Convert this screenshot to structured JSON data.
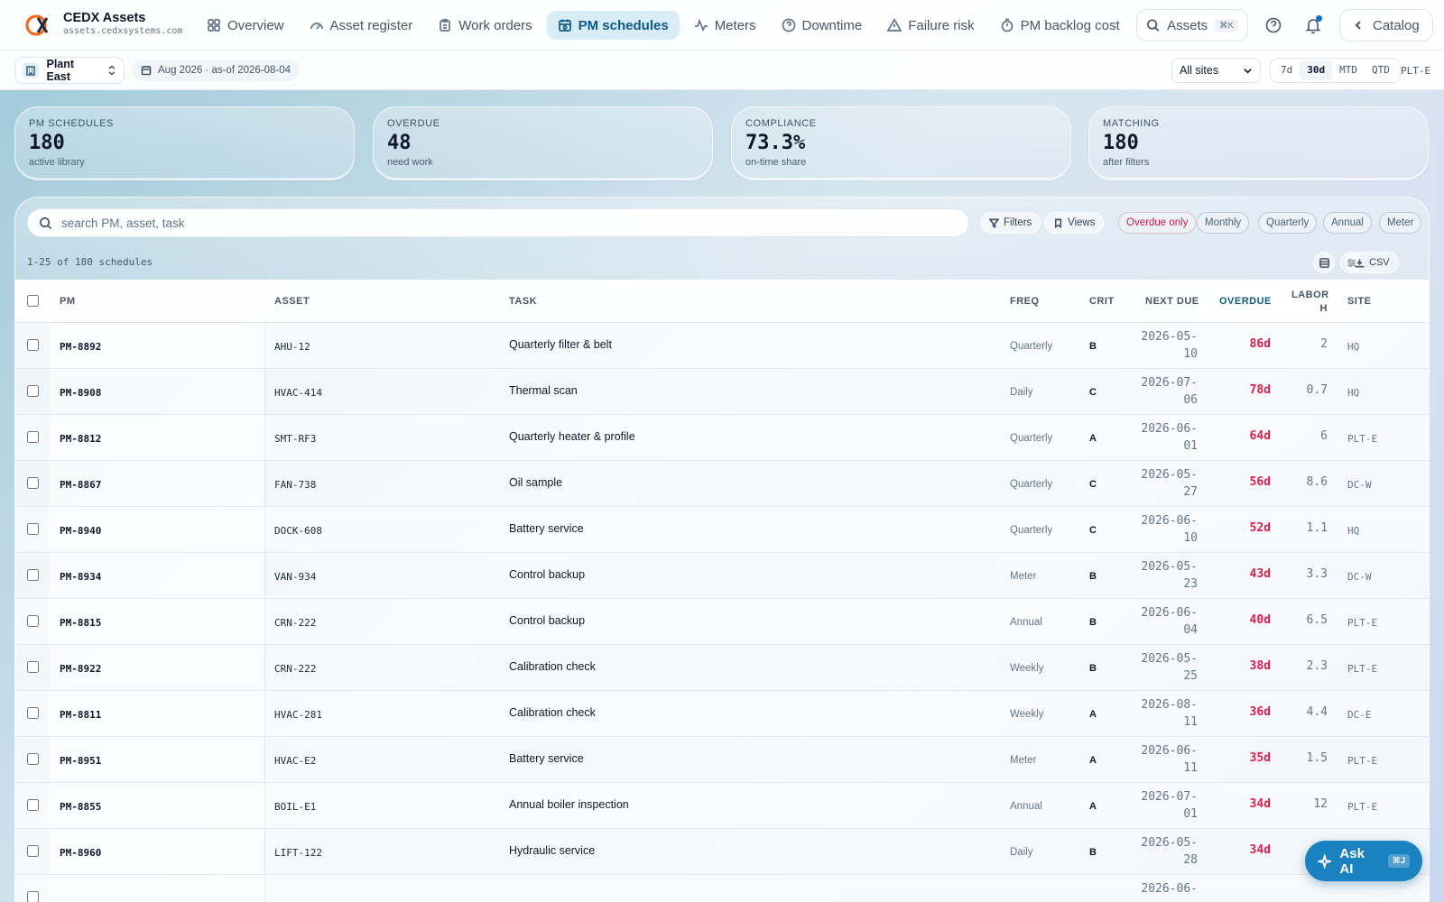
{
  "app": {
    "name": "CEDX Assets",
    "url": "assets.cedxsystems.com"
  },
  "nav": {
    "items": [
      {
        "label": "Overview",
        "icon": "grid-icon"
      },
      {
        "label": "Asset register",
        "icon": "gauge-icon"
      },
      {
        "label": "Work orders",
        "icon": "clipboard-icon"
      },
      {
        "label": "PM schedules",
        "icon": "calendar-icon",
        "active": true
      },
      {
        "label": "Meters",
        "icon": "activity-icon"
      },
      {
        "label": "Downtime",
        "icon": "help-circle-icon"
      },
      {
        "label": "Failure risk",
        "icon": "warning-icon"
      },
      {
        "label": "PM backlog cost",
        "icon": "timer-icon"
      }
    ],
    "search_label": "Assets",
    "search_kbd": "⌘K",
    "catalog_label": "Catalog"
  },
  "subbar": {
    "plant": "Plant East",
    "date_range": "Aug 2026 · as-of 2026-08-04",
    "sites": "All sites",
    "ranges": [
      "7d",
      "30d",
      "MTD",
      "QTD"
    ],
    "active_range": "30d",
    "site_code": "PLT-E"
  },
  "stats": [
    {
      "label": "PM SCHEDULES",
      "value": "180",
      "sub": "active library"
    },
    {
      "label": "OVERDUE",
      "value": "48",
      "sub": "need work"
    },
    {
      "label": "COMPLIANCE",
      "value": "73.3%",
      "sub": "on-time share"
    },
    {
      "label": "MATCHING",
      "value": "180",
      "sub": "after filters"
    }
  ],
  "toolbar": {
    "search_placeholder": "search PM, asset, task",
    "filters_label": "Filters",
    "views_label": "Views",
    "chips": [
      "Overdue only",
      "Monthly",
      "Quarterly",
      "Annual",
      "Meter"
    ],
    "count_text": "1-25 of 180 schedules",
    "csv_label": "CSV"
  },
  "table": {
    "headers": {
      "pm": "PM",
      "asset": "ASSET",
      "task": "TASK",
      "freq": "FREQ",
      "crit": "CRIT",
      "next_due": "NEXT DUE",
      "overdue": "OVERDUE",
      "labor": "LABOR H",
      "site": "SITE"
    },
    "rows": [
      {
        "pm": "PM-8892",
        "asset": "AHU-12",
        "task": "Quarterly filter & belt",
        "freq": "Quarterly",
        "crit": "B",
        "due": "2026-05-10",
        "overdue": "86d",
        "labor": "2",
        "site": "HQ"
      },
      {
        "pm": "PM-8908",
        "asset": "HVAC-414",
        "task": "Thermal scan",
        "freq": "Daily",
        "crit": "C",
        "due": "2026-07-06",
        "overdue": "78d",
        "labor": "0.7",
        "site": "HQ"
      },
      {
        "pm": "PM-8812",
        "asset": "SMT-RF3",
        "task": "Quarterly heater & profile",
        "freq": "Quarterly",
        "crit": "A",
        "due": "2026-06-01",
        "overdue": "64d",
        "labor": "6",
        "site": "PLT-E"
      },
      {
        "pm": "PM-8867",
        "asset": "FAN-738",
        "task": "Oil sample",
        "freq": "Quarterly",
        "crit": "C",
        "due": "2026-05-27",
        "overdue": "56d",
        "labor": "8.6",
        "site": "DC-W"
      },
      {
        "pm": "PM-8940",
        "asset": "DOCK-608",
        "task": "Battery service",
        "freq": "Quarterly",
        "crit": "C",
        "due": "2026-06-10",
        "overdue": "52d",
        "labor": "1.1",
        "site": "HQ"
      },
      {
        "pm": "PM-8934",
        "asset": "VAN-934",
        "task": "Control backup",
        "freq": "Meter",
        "crit": "B",
        "due": "2026-05-23",
        "overdue": "43d",
        "labor": "3.3",
        "site": "DC-W"
      },
      {
        "pm": "PM-8815",
        "asset": "CRN-222",
        "task": "Control backup",
        "freq": "Annual",
        "crit": "B",
        "due": "2026-06-04",
        "overdue": "40d",
        "labor": "6.5",
        "site": "PLT-E"
      },
      {
        "pm": "PM-8922",
        "asset": "CRN-222",
        "task": "Calibration check",
        "freq": "Weekly",
        "crit": "B",
        "due": "2026-05-25",
        "overdue": "38d",
        "labor": "2.3",
        "site": "PLT-E"
      },
      {
        "pm": "PM-8811",
        "asset": "HVAC-281",
        "task": "Calibration check",
        "freq": "Weekly",
        "crit": "A",
        "due": "2026-08-11",
        "overdue": "36d",
        "labor": "4.4",
        "site": "DC-E"
      },
      {
        "pm": "PM-8951",
        "asset": "HVAC-E2",
        "task": "Battery service",
        "freq": "Meter",
        "crit": "A",
        "due": "2026-06-11",
        "overdue": "35d",
        "labor": "1.5",
        "site": "PLT-E"
      },
      {
        "pm": "PM-8855",
        "asset": "BOIL-E1",
        "task": "Annual boiler inspection",
        "freq": "Annual",
        "crit": "A",
        "due": "2026-07-01",
        "overdue": "34d",
        "labor": "12",
        "site": "PLT-E"
      },
      {
        "pm": "PM-8960",
        "asset": "LIFT-122",
        "task": "Hydraulic service",
        "freq": "Daily",
        "crit": "B",
        "due": "2026-05-28",
        "overdue": "34d",
        "labor": "",
        "site": ""
      }
    ],
    "partial_row_due": "2026-06-"
  },
  "ask_ai": {
    "label": "Ask AI",
    "kbd": "⌘J"
  },
  "colors": {
    "accent": "#0e5a86",
    "overdue": "#e11d48",
    "ask_ai_bg": "#1b82c0"
  }
}
